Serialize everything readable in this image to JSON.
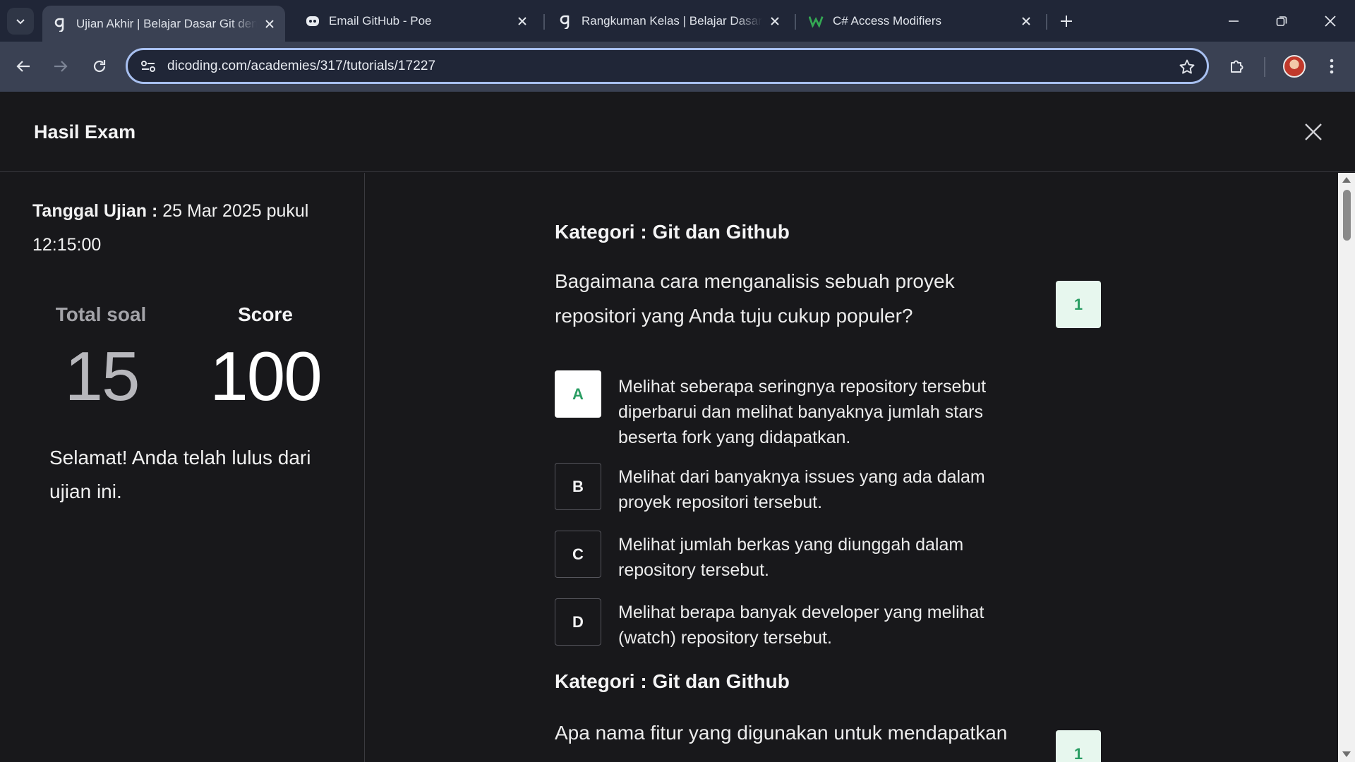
{
  "browser": {
    "tabs": [
      {
        "title": "Ujian Akhir | Belajar Dasar Git dengan GitHub",
        "favicon": "dicoding-icon",
        "active": true
      },
      {
        "title": "Email GitHub - Poe",
        "favicon": "poe-icon",
        "active": false
      },
      {
        "title": "Rangkuman Kelas | Belajar Dasar Git dengan GitHub",
        "favicon": "dicoding-icon",
        "active": false
      },
      {
        "title": "C# Access Modifiers",
        "favicon": "w3schools-icon",
        "active": false
      }
    ],
    "url": "dicoding.com/academies/317/tutorials/17227"
  },
  "page": {
    "title": "Hasil Exam"
  },
  "summary": {
    "date_label": "Tanggal Ujian :",
    "date_value": "25 Mar 2025 pukul 12:15:00",
    "total_label": "Total soal",
    "total_value": "15",
    "score_label": "Score",
    "score_value": "100",
    "message": "Selamat! Anda telah lulus dari ujian ini."
  },
  "questions": [
    {
      "category": "Kategori : Git dan Github",
      "text": "Bagaimana cara menganalisis sebuah proyek repositori yang Anda tuju cukup populer?",
      "number": "1",
      "options": [
        {
          "letter": "A",
          "text": "Melihat seberapa seringnya repository tersebut diperbarui dan melihat banyaknya jumlah stars beserta fork yang didapatkan.",
          "selected": true
        },
        {
          "letter": "B",
          "text": "Melihat dari banyaknya issues yang ada dalam proyek repositori tersebut.",
          "selected": false
        },
        {
          "letter": "C",
          "text": "Melihat jumlah berkas yang diunggah dalam repository tersebut.",
          "selected": false
        },
        {
          "letter": "D",
          "text": "Melihat berapa banyak developer yang melihat (watch) repository tersebut.",
          "selected": false
        }
      ]
    },
    {
      "category": "Kategori : Git dan Github",
      "text": "Apa nama fitur yang digunakan untuk mendapatkan",
      "number": "1"
    }
  ],
  "colors": {
    "correct": "#2a9d63",
    "badge_bg": "#e7f7ee",
    "page_bg": "#18181b",
    "chrome_bg": "#202637",
    "toolbar_bg": "#3a4153"
  }
}
